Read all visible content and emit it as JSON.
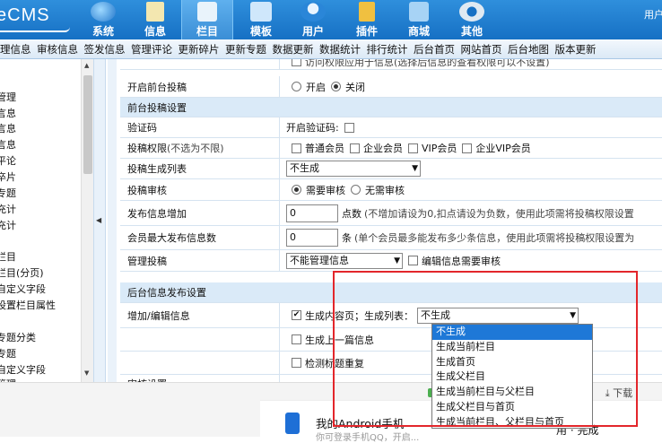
{
  "topbar": {
    "logo": "eCMS",
    "nav": [
      {
        "label": "系统",
        "icon": "system-globe-icon",
        "active": false
      },
      {
        "label": "信息",
        "icon": "notepad-icon",
        "active": false
      },
      {
        "label": "栏目",
        "icon": "column-folder-icon",
        "active": true
      },
      {
        "label": "模板",
        "icon": "template-screen-icon",
        "active": false
      },
      {
        "label": "用户",
        "icon": "user-icon",
        "active": false
      },
      {
        "label": "插件",
        "icon": "plugin-tools-icon",
        "active": false
      },
      {
        "label": "商城",
        "icon": "shop-cart-icon",
        "active": false
      },
      {
        "label": "其他",
        "icon": "other-gear-icon",
        "active": false
      }
    ],
    "user_link": "用户"
  },
  "subnav": [
    "理信息",
    "审核信息",
    "签发信息",
    "管理评论",
    "更新碎片",
    "更新专题",
    "数据更新",
    "数据统计",
    "排行统计",
    "后台首页",
    "网站首页",
    "后台地图",
    "版本更新"
  ],
  "sidebar": {
    "items": [
      "管理",
      "言息",
      "言息",
      "言息",
      "平论",
      "卒片",
      "专题",
      "充计",
      "充计",
      "",
      "栏目",
      "栏目(分页)",
      "自定义字段",
      "设置栏目属性",
      "",
      "专题分类",
      "专题",
      "自定义字段",
      "管理"
    ]
  },
  "form": {
    "rows": [
      {
        "label": "",
        "text": "访问权限应用于信息(选择后信息的查看权限可以不设置)"
      },
      {
        "label": "开启前台投稿",
        "radio": [
          "开启",
          "关闭"
        ],
        "selected": 1
      },
      {
        "section": "前台投稿设置"
      },
      {
        "label": "验证码",
        "checkbox_prefix": "开启验证码:"
      },
      {
        "label": "投稿权限",
        "label_note": "(不选为不限)",
        "checks": [
          "普通会员",
          "企业会员",
          "VIP会员",
          "企业VIP会员"
        ]
      },
      {
        "label": "投稿生成列表",
        "select": "不生成"
      },
      {
        "label": "投稿审核",
        "radio": [
          "需要审核",
          "无需审核"
        ],
        "selected": 0
      },
      {
        "label": "发布信息增加",
        "input": "0",
        "unit": "点数",
        "note": "(不增加请设为0,扣点请设为负数，使用此项需将投稿权限设置"
      },
      {
        "label": "会员最大发布信息数",
        "input": "0",
        "unit": "条",
        "note": "(单个会员最多能发布多少条信息，使用此项需将投稿权限设置为"
      },
      {
        "label": "管理投稿",
        "select": "不能管理信息",
        "check_after": "编辑信息需要审核"
      },
      {
        "section": "后台信息发布设置"
      },
      {
        "label": "增加/编辑信息",
        "check_main": "生成内容页；生成列表：",
        "select": "不生成"
      },
      {
        "label": "",
        "check_main": "生成上一篇信息"
      },
      {
        "label": "",
        "check_main": "检测标题重复"
      },
      {
        "label": "审核设置",
        "text": ""
      }
    ]
  },
  "dropdown": {
    "options": [
      "不生成",
      "生成当前栏目",
      "生成首页",
      "生成父栏目",
      "生成当前栏目与父栏目",
      "生成父栏目与首页",
      "生成当前栏目、父栏目与首页"
    ],
    "highlighted": 0
  },
  "bottom": {
    "card_title": "我的Android手机",
    "card_sub": "你可登录手机QQ，开启...",
    "card_right": "用 · 完成",
    "quick_label": "下载"
  },
  "colors": {
    "accent": "#1e78d7",
    "highlight_box": "#e3262b",
    "topbar": "#1670c4"
  }
}
